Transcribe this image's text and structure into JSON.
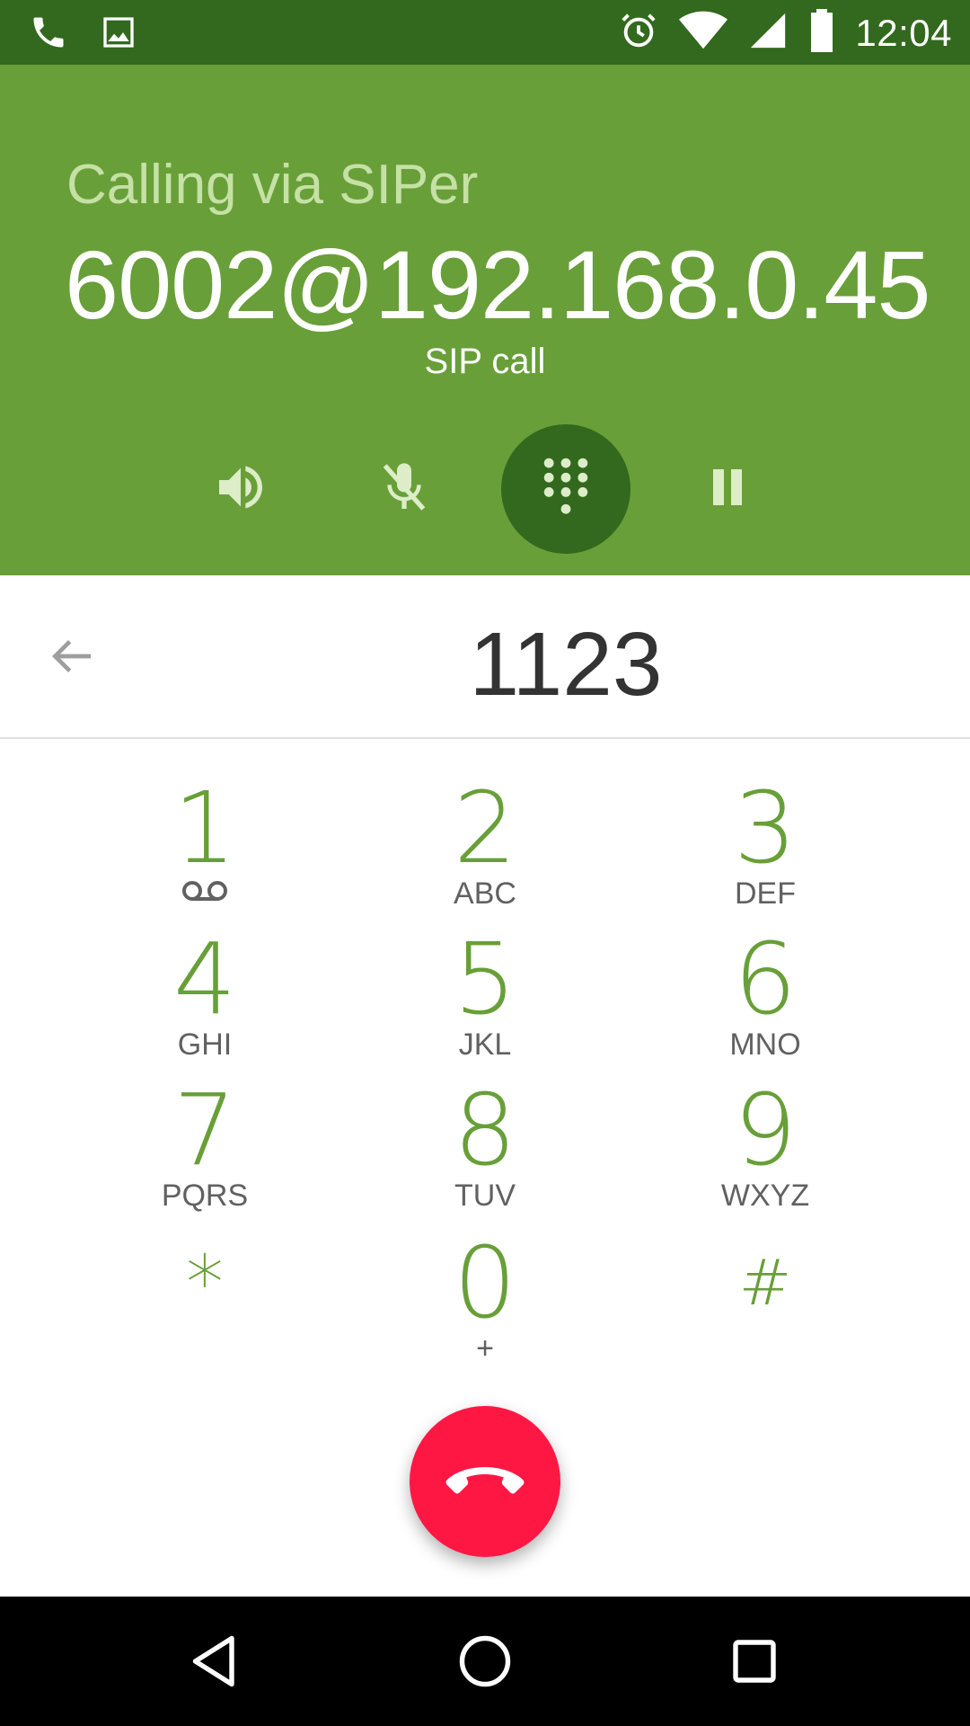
{
  "status_bar": {
    "time": "12:04",
    "icons": [
      "phone-icon",
      "image-icon",
      "alarm-icon",
      "wifi-icon",
      "signal-icon",
      "battery-icon"
    ]
  },
  "call": {
    "via_label": "Calling via SIPer",
    "callee": "6002@192.168.0.45",
    "call_type": "SIP call",
    "controls": [
      "speaker-icon",
      "mute-icon",
      "dialpad-icon",
      "pause-icon"
    ]
  },
  "dialpad": {
    "digits": "1123",
    "keys": [
      {
        "num": "1",
        "letters": ""
      },
      {
        "num": "2",
        "letters": "ABC"
      },
      {
        "num": "3",
        "letters": "DEF"
      },
      {
        "num": "4",
        "letters": "GHI"
      },
      {
        "num": "5",
        "letters": "JKL"
      },
      {
        "num": "6",
        "letters": "MNO"
      },
      {
        "num": "7",
        "letters": "PQRS"
      },
      {
        "num": "8",
        "letters": "TUV"
      },
      {
        "num": "9",
        "letters": "WXYZ"
      },
      {
        "num": "*",
        "letters": ""
      },
      {
        "num": "0",
        "letters": "+"
      },
      {
        "num": "#",
        "letters": ""
      }
    ]
  },
  "colors": {
    "status_bar": "#33691e",
    "header": "#689f38",
    "accent": "#689f38",
    "end_call": "#ff1744"
  },
  "nav": [
    "back-icon",
    "home-icon",
    "recents-icon"
  ]
}
